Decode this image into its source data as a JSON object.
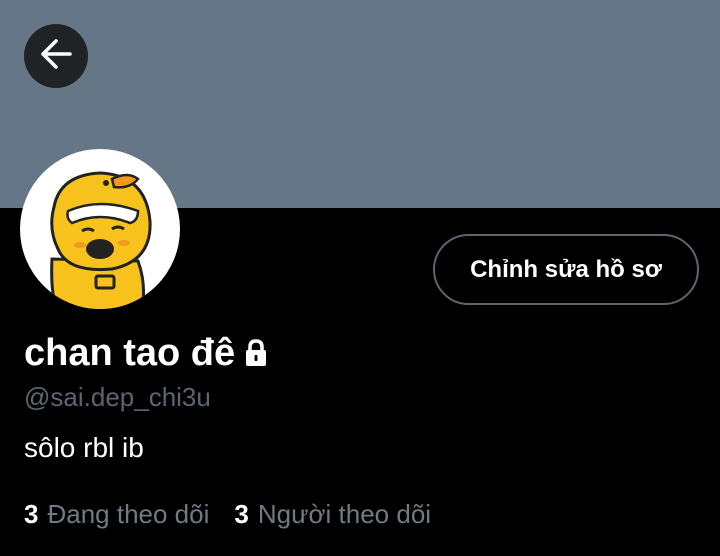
{
  "profile": {
    "display_name": "chan tao đê",
    "handle": "@sai.dep_chi3u",
    "bio": "sôlo rbl ib",
    "edit_button_label": "Chỉnh sửa hồ sơ",
    "protected_icon": "lock-icon",
    "avatar": "yellow-duck-character-avatar"
  },
  "header": {
    "back_icon": "arrow-left-icon",
    "banner_color": "#657786"
  },
  "stats": {
    "following_count": "3",
    "following_label": "Đang theo dõi",
    "followers_count": "3",
    "followers_label": "Người theo dõi"
  }
}
